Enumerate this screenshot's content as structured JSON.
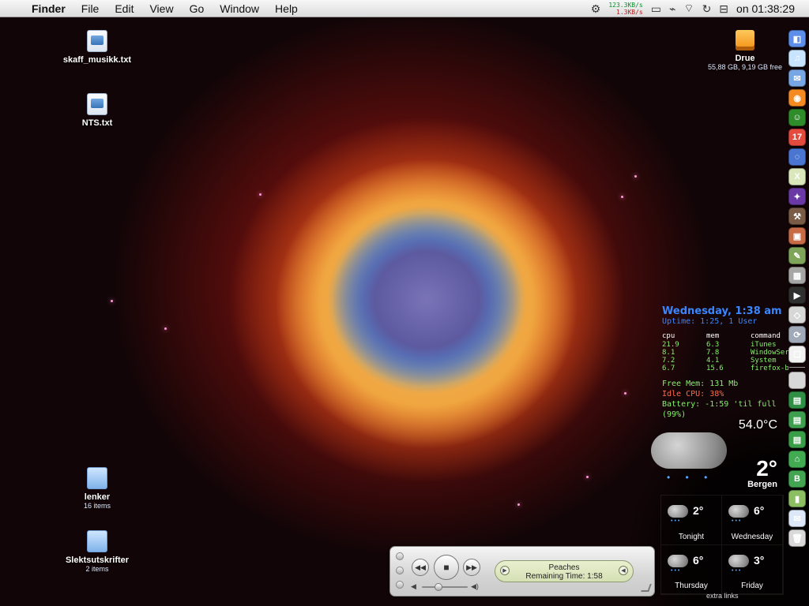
{
  "menubar": {
    "apple_icon": "",
    "app_name": "Finder",
    "items": [
      "File",
      "Edit",
      "View",
      "Go",
      "Window",
      "Help"
    ],
    "net_up": "123.3KB/s",
    "net_down": "1.3KB/s",
    "clock": "on 01:38:29",
    "status_icons": [
      "gear-icon",
      "battery-icon",
      "activity-icon",
      "wifi-icon",
      "sync-icon",
      "power-plug-icon"
    ]
  },
  "desktop": {
    "files": [
      {
        "label": "skaff_musikk.txt"
      },
      {
        "label": "NTS.txt"
      }
    ],
    "folders": [
      {
        "label": "lenker",
        "sub": "16 items"
      },
      {
        "label": "Slektsutskrifter",
        "sub": "2 items"
      }
    ],
    "drive": {
      "label": "Drue",
      "sub": "55,88 GB, 9,19 GB free"
    }
  },
  "dock": {
    "items": [
      {
        "name": "finder-icon",
        "glyph": "◧",
        "color": "#5d8ee9"
      },
      {
        "name": "itunes-icon",
        "glyph": "♫",
        "color": "#c8e4ff"
      },
      {
        "name": "mail-icon",
        "glyph": "✉",
        "color": "#78a5e4"
      },
      {
        "name": "firefox-icon",
        "glyph": "◉",
        "color": "#f58a22"
      },
      {
        "name": "adium-icon",
        "glyph": "☺",
        "color": "#2f8c2a"
      },
      {
        "name": "calendar-icon",
        "glyph": "17",
        "color": "#e44b3f"
      },
      {
        "name": "network-icon",
        "glyph": "◌",
        "color": "#4a76d1"
      },
      {
        "name": "x11-icon",
        "glyph": "X",
        "color": "#d9e7bb"
      },
      {
        "name": "space-icon",
        "glyph": "✦",
        "color": "#6a39a6"
      },
      {
        "name": "tools-icon",
        "glyph": "⚒",
        "color": "#7a5b45"
      },
      {
        "name": "photo-icon",
        "glyph": "▣",
        "color": "#c86a45"
      },
      {
        "name": "edit-icon",
        "glyph": "✎",
        "color": "#7fa55a"
      },
      {
        "name": "calculator-icon",
        "glyph": "▦",
        "color": "#a6a6a6"
      },
      {
        "name": "terminal-icon",
        "glyph": "▶",
        "color": "#2f2f2f"
      },
      {
        "name": "cube-icon",
        "glyph": "◇",
        "color": "#d7d7d7"
      },
      {
        "name": "sync-app-icon",
        "glyph": "⟳",
        "color": "#9fa9b8"
      },
      {
        "name": "contacts-icon",
        "glyph": "☐",
        "color": "#f2f2f2"
      },
      {
        "name": "apple-icon",
        "glyph": "",
        "color": "#d8d8d8"
      },
      {
        "name": "green-folder-1-icon",
        "glyph": "▤",
        "color": "#2f8f44"
      },
      {
        "name": "green-folder-2-icon",
        "glyph": "▤",
        "color": "#3ea04f"
      },
      {
        "name": "green-folder-3-icon",
        "glyph": "▤",
        "color": "#3a9d48"
      },
      {
        "name": "green-folder-4-icon",
        "glyph": "⌂",
        "color": "#42ab52"
      },
      {
        "name": "green-folder-5-icon",
        "glyph": "B",
        "color": "#43a451"
      },
      {
        "name": "document-icon",
        "glyph": "▮",
        "color": "#8bbf62"
      },
      {
        "name": "mail-folder-icon",
        "glyph": "✉",
        "color": "#dce7f8"
      },
      {
        "name": "trash-icon",
        "glyph": "🗑",
        "color": "#d9d9d9"
      }
    ]
  },
  "sysinfo": {
    "headline": "Wednesday, 1:38 am",
    "uptime": "Uptime:   1:25, 1 User",
    "headers": [
      "cpu",
      "mem",
      "command"
    ],
    "processes": [
      {
        "cpu": "21.9",
        "mem": "6.3",
        "command": "iTunes"
      },
      {
        "cpu": "8.1",
        "mem": "7.8",
        "command": "WindowServer"
      },
      {
        "cpu": "7.2",
        "mem": "4.1",
        "command": "System"
      },
      {
        "cpu": "6.7",
        "mem": "15.6",
        "command": "firefox-bin"
      }
    ],
    "free_mem": "Free Mem: 131 Mb",
    "idle_cpu": "Idle CPU: 38%",
    "battery": "Battery: -1:59 'til full (99%)"
  },
  "weather": {
    "top_temp": "54.0°C",
    "current_temp": "2°",
    "city": "Bergen",
    "days": [
      {
        "name": "Tonight",
        "temp": "2°"
      },
      {
        "name": "Wednesday",
        "temp": "6°"
      },
      {
        "name": "Thursday",
        "temp": "6°"
      },
      {
        "name": "Friday",
        "temp": "3°"
      }
    ],
    "extra_links": "extra links"
  },
  "player": {
    "track": "Peaches",
    "remaining": "Remaining Time: 1:58",
    "prev": "◀◀",
    "play": "■",
    "next": "▶▶",
    "vol_low": "◀",
    "vol_high": "◀)",
    "lcd_left": "▶",
    "lcd_right": "◀"
  }
}
